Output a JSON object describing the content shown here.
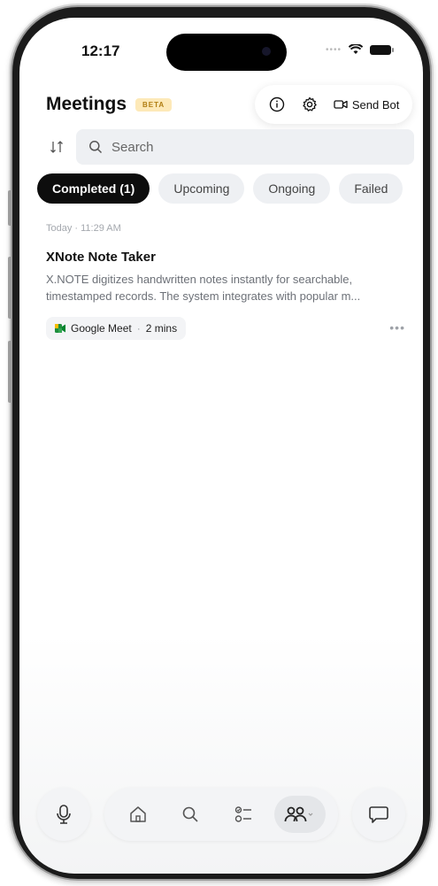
{
  "status_bar": {
    "time": "12:17"
  },
  "header": {
    "title": "Meetings",
    "badge": "BETA",
    "send_bot_label": "Send Bot",
    "icons": [
      "info-icon",
      "gear-icon",
      "video-camera-icon"
    ]
  },
  "search": {
    "placeholder": "Search"
  },
  "tabs": [
    {
      "label": "Completed (1)",
      "active": true
    },
    {
      "label": "Upcoming",
      "active": false
    },
    {
      "label": "Ongoing",
      "active": false
    },
    {
      "label": "Failed",
      "active": false
    }
  ],
  "meetings": [
    {
      "timestamp": "Today · 11:29 AM",
      "title": "XNote Note Taker",
      "description": "X.NOTE digitizes handwritten notes instantly for searchable, timestamped records. The system integrates with popular m...",
      "platform": "Google Meet",
      "duration": "2 mins"
    }
  ],
  "bottom_nav": {
    "items": [
      "microphone-icon",
      "home-icon",
      "search-icon",
      "tasks-icon",
      "people-icon",
      "chat-icon"
    ],
    "active": "people-icon"
  },
  "colors": {
    "accent": "#0d0d0d",
    "beta_bg": "#fde9b8",
    "beta_text": "#b07d12",
    "muted": "#6d7178"
  }
}
